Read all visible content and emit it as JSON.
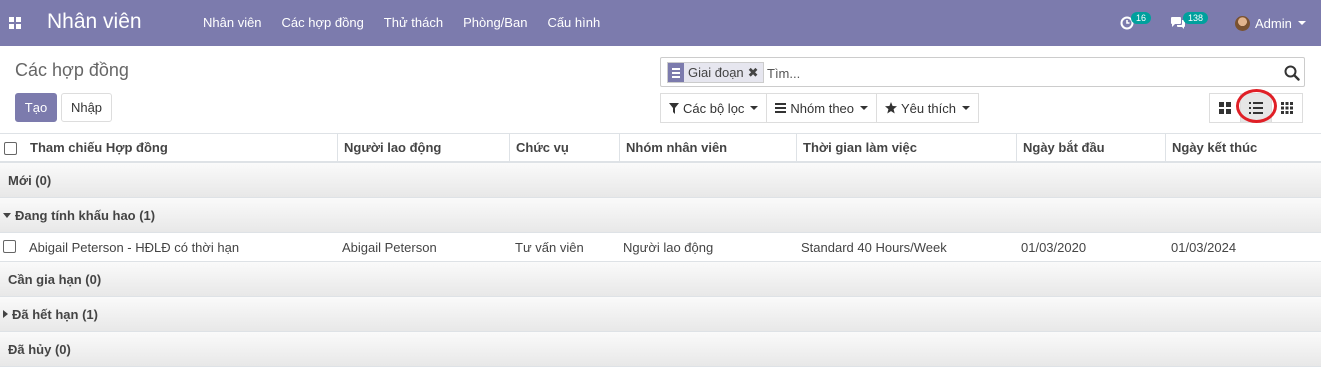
{
  "app": {
    "title": "Nhân viên"
  },
  "menu": [
    {
      "label": "Nhân viên"
    },
    {
      "label": "Các hợp đồng"
    },
    {
      "label": "Thử thách"
    },
    {
      "label": "Phòng/Ban"
    },
    {
      "label": "Cấu hình"
    }
  ],
  "systray": {
    "activity_count": "16",
    "message_count": "138",
    "user_name": "Admin"
  },
  "page": {
    "title": "Các hợp đồng",
    "create_label": "Tạo",
    "import_label": "Nhập"
  },
  "search": {
    "facet_label": "Giai đoạn",
    "facet_remove": "✖",
    "placeholder": "Tìm..."
  },
  "filters": {
    "filter_label": "Các bộ lọc",
    "groupby_label": "Nhóm theo",
    "favorites_label": "Yêu thích"
  },
  "views": {
    "active": "list",
    "available": [
      "kanban",
      "list",
      "activity"
    ]
  },
  "table": {
    "columns": [
      "Tham chiếu Hợp đồng",
      "Người lao động",
      "Chức vụ",
      "Nhóm nhân viên",
      "Thời gian làm việc",
      "Ngày bắt đầu",
      "Ngày kết thúc"
    ],
    "groups": [
      {
        "label": "Mới (0)",
        "state": "none",
        "rows": []
      },
      {
        "label": "Đang tính khấu hao (1)",
        "state": "open",
        "rows": [
          [
            "Abigail Peterson - HĐLĐ có thời hạn",
            "Abigail Peterson",
            "Tư vấn viên",
            "Người lao động",
            "Standard 40 Hours/Week",
            "01/03/2020",
            "01/03/2024"
          ]
        ]
      },
      {
        "label": "Cần gia hạn (0)",
        "state": "none",
        "rows": []
      },
      {
        "label": "Đã hết hạn (1)",
        "state": "closed",
        "rows": []
      },
      {
        "label": "Đã hủy (0)",
        "state": "none",
        "rows": []
      }
    ]
  },
  "colors": {
    "brand": "#7c7bad",
    "badge": "#00a09d",
    "highlight_circle": "#e01f26"
  }
}
